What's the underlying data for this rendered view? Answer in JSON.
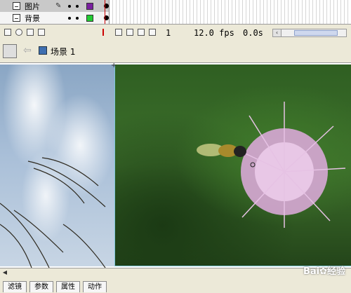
{
  "timeline": {
    "layers": [
      {
        "name": "图片",
        "pencil": "✎",
        "swatch_color": "#7a1fa0",
        "selected": true
      },
      {
        "name": "背景",
        "pencil": "",
        "swatch_color": "#22cc33",
        "selected": false
      }
    ],
    "current_frame": "1",
    "fps": "12.0 fps",
    "time": "0.0s",
    "scroll_left_icon": "‹"
  },
  "edit_bar": {
    "back_arrow": "⇦",
    "scene_label": "场景 1"
  },
  "bottom_scroll": {
    "arrow": "◀"
  },
  "watermark": "Bai✿经验",
  "bottom_tabs": [
    "滤镜",
    "参数",
    "属性",
    "动作"
  ]
}
